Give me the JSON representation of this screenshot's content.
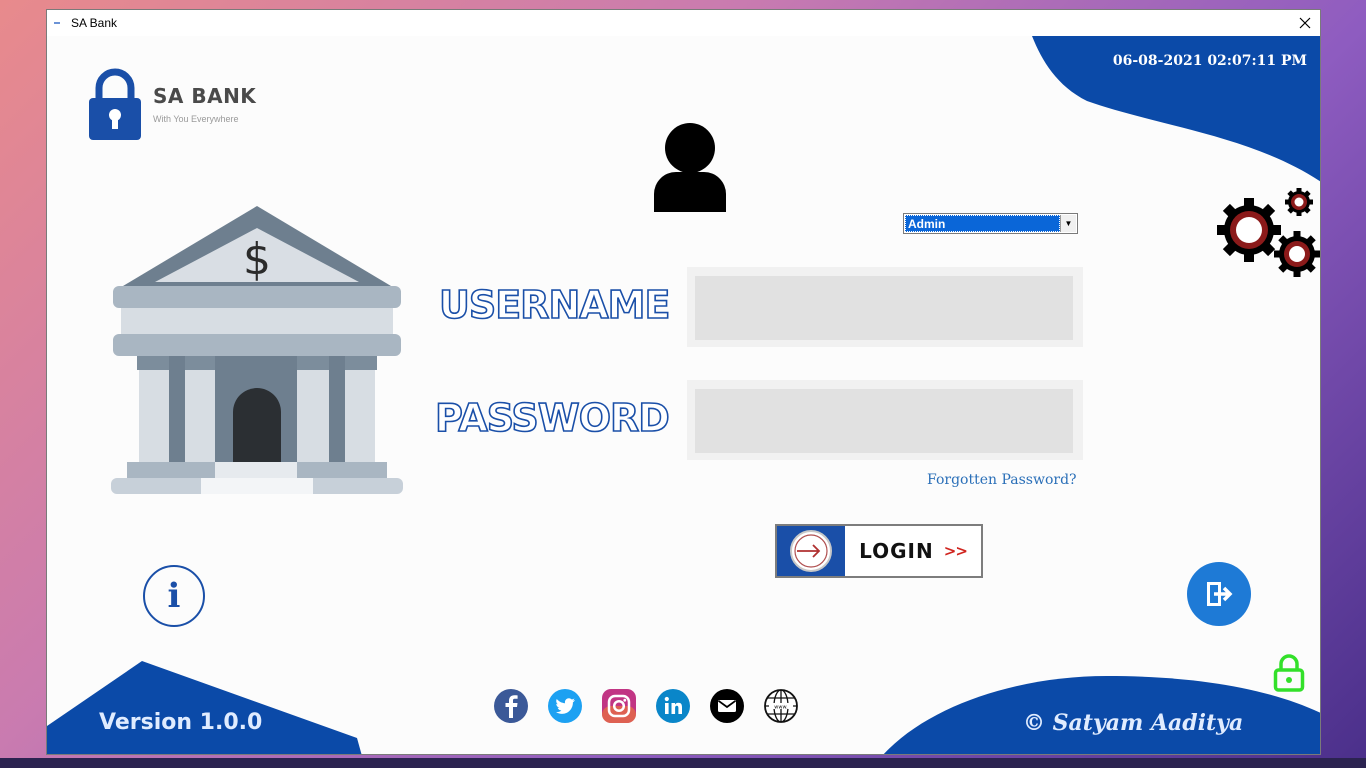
{
  "window": {
    "title": "SA Bank",
    "close_glyph": "✕"
  },
  "header": {
    "datetime": "06-08-2021 02:07:11 PM"
  },
  "logo": {
    "name": "SA BANK",
    "tagline": "With You Everywhere",
    "icon": "padlock-icon"
  },
  "bank_icon": {
    "symbol": "$"
  },
  "login_form": {
    "role_selected": "Admin",
    "username_label": "USERNAME",
    "username_value": "",
    "password_label": "PASSWORD",
    "password_value": "",
    "forgot_label": "Forgotten Password?",
    "login_label": "LOGIN",
    "login_arrows": ">>"
  },
  "info": {
    "glyph": "i"
  },
  "footer": {
    "version": "Version 1.0.0",
    "copyright": "© Satyam Aaditya"
  },
  "social_icons": [
    "facebook-icon",
    "twitter-icon",
    "instagram-icon",
    "linkedin-icon",
    "email-icon",
    "website-icon"
  ],
  "colors": {
    "brand_blue": "#1a4fa8",
    "corner_blue": "#0b4aa8",
    "exit_blue": "#1e7ad6",
    "lock_green": "#33e02a",
    "forgot_link": "#2a6fb8",
    "gear_red": "#8b1a1a"
  }
}
